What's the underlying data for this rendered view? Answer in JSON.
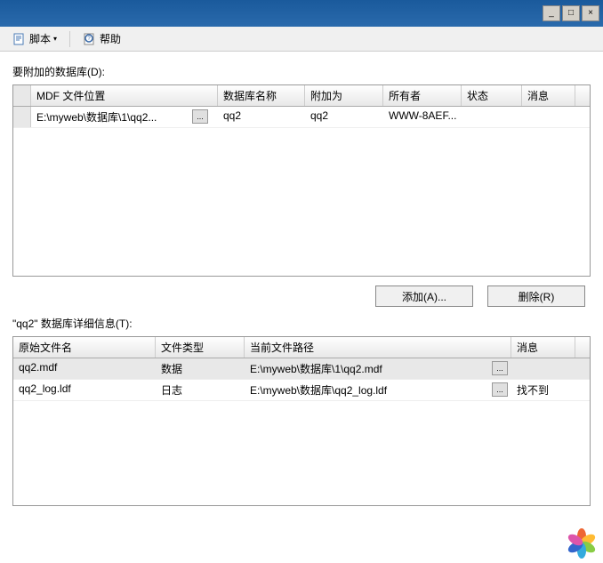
{
  "window": {
    "min": "_",
    "max": "□",
    "close": "×"
  },
  "toolbar": {
    "script": "脚本",
    "dropdown": "▾",
    "help": "帮助"
  },
  "attach": {
    "label": "要附加的数据库(D):",
    "headers": [
      "MDF 文件位置",
      "数据库名称",
      "附加为",
      "所有者",
      "状态",
      "消息"
    ],
    "rows": [
      {
        "path": "E:\\myweb\\数据库\\1\\qq2...",
        "browse": "...",
        "dbname": "qq2",
        "attachas": "qq2",
        "owner": "WWW-8AEF...",
        "status": "",
        "message": ""
      }
    ]
  },
  "buttons": {
    "add": "添加(A)...",
    "remove": "删除(R)"
  },
  "details": {
    "label": "\"qq2\" 数据库详细信息(T):",
    "headers": [
      "原始文件名",
      "文件类型",
      "当前文件路径",
      "消息"
    ],
    "rows": [
      {
        "filename": "qq2.mdf",
        "type": "数据",
        "path": "E:\\myweb\\数据库\\1\\qq2.mdf",
        "browse": "...",
        "message": ""
      },
      {
        "filename": "qq2_log.ldf",
        "type": "日志",
        "path": "E:\\myweb\\数据库\\qq2_log.ldf",
        "browse": "...",
        "message": "找不到"
      }
    ]
  }
}
